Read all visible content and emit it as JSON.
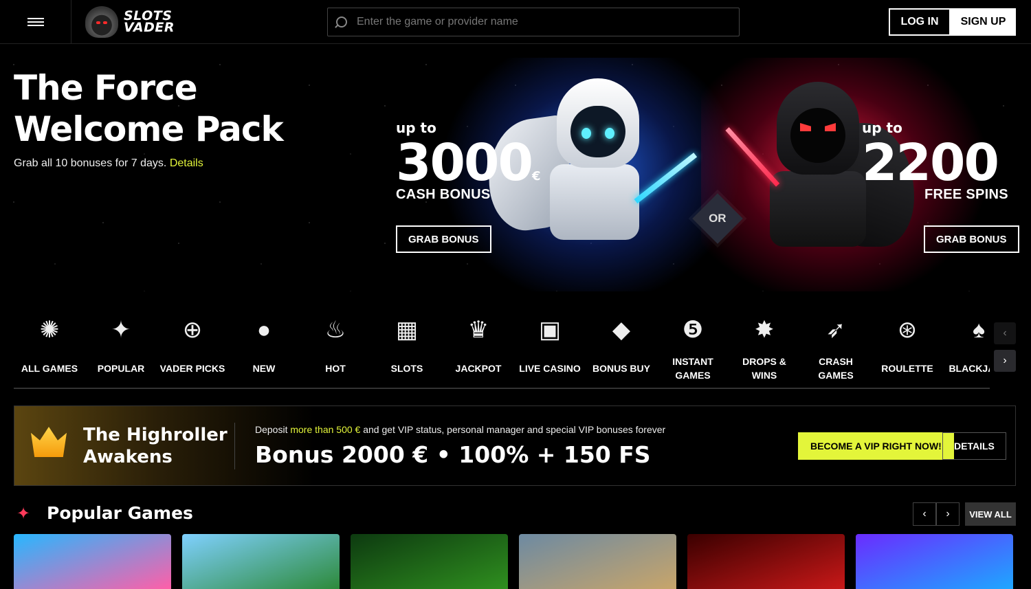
{
  "header": {
    "logo": {
      "line1": "SLOTS",
      "line2": "VADER"
    },
    "search": {
      "placeholder": "Enter the game or provider name"
    },
    "login_label": "LOG IN",
    "signup_label": "SIGN UP"
  },
  "hero": {
    "title_line1": "The Force",
    "title_line2": "Welcome Pack",
    "subtitle": "Grab all 10 bonuses for 7 days.",
    "details_link": "Details",
    "left_offer": {
      "up_to": "up to",
      "amount": "3000",
      "currency": "€",
      "label": "CASH BONUS",
      "button": "GRAB BONUS"
    },
    "or_label": "OR",
    "right_offer": {
      "up_to": "up to",
      "amount": "2200",
      "label": "FREE SPINS",
      "button": "GRAB BONUS"
    }
  },
  "categories": [
    {
      "label": "ALL GAMES",
      "icon": "galaxy-icon"
    },
    {
      "label": "POPULAR",
      "icon": "sparkle-icon"
    },
    {
      "label": "VADER PICKS",
      "icon": "compass-star-icon"
    },
    {
      "label": "NEW",
      "icon": "planet-icon"
    },
    {
      "label": "HOT",
      "icon": "flame-icon"
    },
    {
      "label": "SLOTS",
      "icon": "slot-machine-icon"
    },
    {
      "label": "JACKPOT",
      "icon": "jackpot-crown-icon"
    },
    {
      "label": "LIVE CASINO",
      "icon": "live-dealer-icon"
    },
    {
      "label": "BONUS BUY",
      "icon": "diamond-icon"
    },
    {
      "label": "INSTANT GAMES",
      "icon": "ball-five-icon"
    },
    {
      "label": "DROPS & WINS",
      "icon": "drops-wins-icon"
    },
    {
      "label": "CRASH GAMES",
      "icon": "rocket-icon"
    },
    {
      "label": "ROULETTE",
      "icon": "roulette-icon"
    },
    {
      "label": "BLACKJACK",
      "icon": "cards-icon"
    }
  ],
  "category_nav": {
    "prev": "‹",
    "next": "›"
  },
  "vip": {
    "title_line1": "The Highroller",
    "title_line2": "Awakens",
    "desc_pre": "Deposit",
    "desc_highlight": "more than 500 €",
    "desc_post": "and get VIP status, personal manager and special VIP bonuses forever",
    "bonus": "Bonus 2000 € • 100% + 150 FS",
    "cta": "BECOME A VIP RIGHT NOW!",
    "details": "DETAILS"
  },
  "popular": {
    "title": "Popular Games",
    "prev": "‹",
    "next": "›",
    "view_all": "VIEW ALL",
    "tiles": [
      {
        "colors": [
          "#27b7ff",
          "#ff5fa8"
        ]
      },
      {
        "colors": [
          "#7fd0ff",
          "#2d8a3a"
        ]
      },
      {
        "colors": [
          "#0d3a10",
          "#2f8f1f"
        ]
      },
      {
        "colors": [
          "#6d8aa2",
          "#c8a56a"
        ]
      },
      {
        "colors": [
          "#3a0000",
          "#c81818"
        ]
      },
      {
        "colors": [
          "#6a2cff",
          "#1ea7ff"
        ]
      }
    ]
  },
  "colors": {
    "accent": "#e3f53a",
    "bg": "#000000",
    "popular_icon": "#ff3a5a"
  }
}
